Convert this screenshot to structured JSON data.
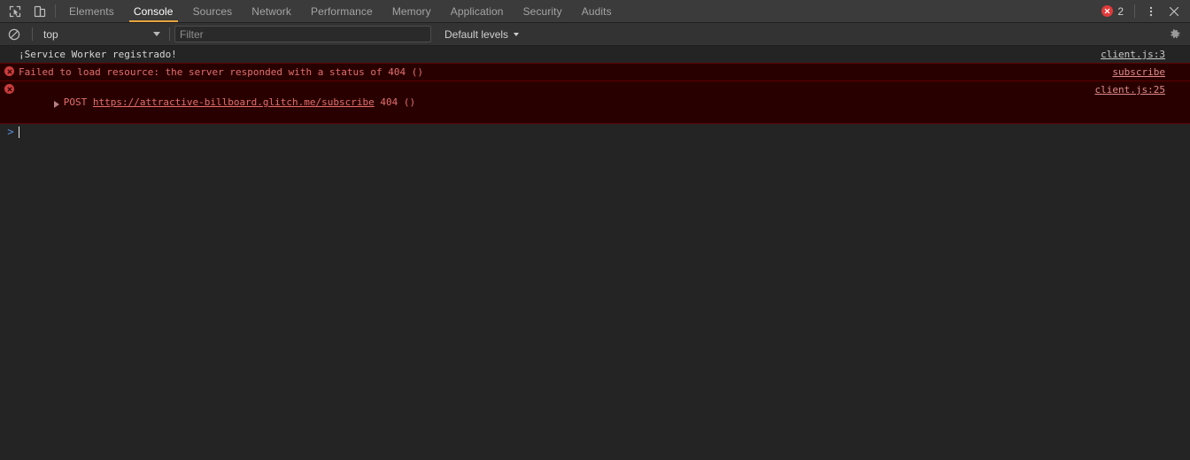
{
  "tabbar": {
    "inspect_icon": "inspect-cursor-icon",
    "device_icon": "device-toolbar-icon",
    "tabs": [
      {
        "label": "Elements",
        "active": false
      },
      {
        "label": "Console",
        "active": true
      },
      {
        "label": "Sources",
        "active": false
      },
      {
        "label": "Network",
        "active": false
      },
      {
        "label": "Performance",
        "active": false
      },
      {
        "label": "Memory",
        "active": false
      },
      {
        "label": "Application",
        "active": false
      },
      {
        "label": "Security",
        "active": false
      },
      {
        "label": "Audits",
        "active": false
      }
    ],
    "error_count": "2",
    "more_icon": "kebab-menu-icon",
    "close_icon": "close-icon"
  },
  "filterbar": {
    "clear_icon": "clear-console-icon",
    "context": "top",
    "filter_placeholder": "Filter",
    "filter_value": "",
    "levels_label": "Default levels",
    "settings_icon": "gear-icon"
  },
  "console": {
    "messages": [
      {
        "level": "log",
        "text": "¡Service Worker registrado!",
        "source": "client.js:3"
      },
      {
        "level": "error",
        "text": "Failed to load resource: the server responded with a status of 404 ()",
        "source": "subscribe"
      },
      {
        "level": "error",
        "expandable": true,
        "prefix": "POST ",
        "link": "https://attractive-billboard.glitch.me/subscribe",
        "suffix": " 404 ()",
        "source": "client.js:25"
      }
    ],
    "prompt_symbol": ">",
    "prompt_value": ""
  },
  "colors": {
    "accent": "#e8a33d",
    "error_red": "#e03a3a",
    "error_bg": "#290000",
    "error_border": "#5c0000",
    "panel_bg": "#242424",
    "toolbar_bg": "#333333",
    "tabbar_bg": "#3b3b3b",
    "prompt_blue": "#5b8dd9"
  }
}
